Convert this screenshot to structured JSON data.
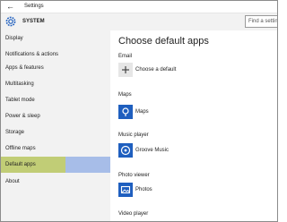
{
  "window": {
    "title": "Settings"
  },
  "header": {
    "section_title": "SYSTEM",
    "search_placeholder": "Find a setting",
    "icon": "gear-icon"
  },
  "sidebar": {
    "items": [
      {
        "label": "Display"
      },
      {
        "label": "Notifications & actions"
      },
      {
        "label": "Apps & features"
      },
      {
        "label": "Multitasking"
      },
      {
        "label": "Tablet mode"
      },
      {
        "label": "Power & sleep"
      },
      {
        "label": "Storage"
      },
      {
        "label": "Offline maps"
      },
      {
        "label": "Default apps",
        "selected": true
      },
      {
        "label": "About"
      }
    ],
    "selected_color": "#a7bde8",
    "highlight_color": "#c6d061"
  },
  "main": {
    "heading": "Choose default apps",
    "sections": [
      {
        "category": "Email",
        "app": "Choose a default",
        "icon": "plus-icon"
      },
      {
        "category": "Maps",
        "app": "Maps",
        "icon": "maps-icon"
      },
      {
        "category": "Music player",
        "app": "Groove Music",
        "icon": "groove-music-icon"
      },
      {
        "category": "Photo viewer",
        "app": "Photos",
        "icon": "photos-icon"
      },
      {
        "category": "Video player"
      }
    ],
    "accent_color": "#1f5fbf"
  }
}
